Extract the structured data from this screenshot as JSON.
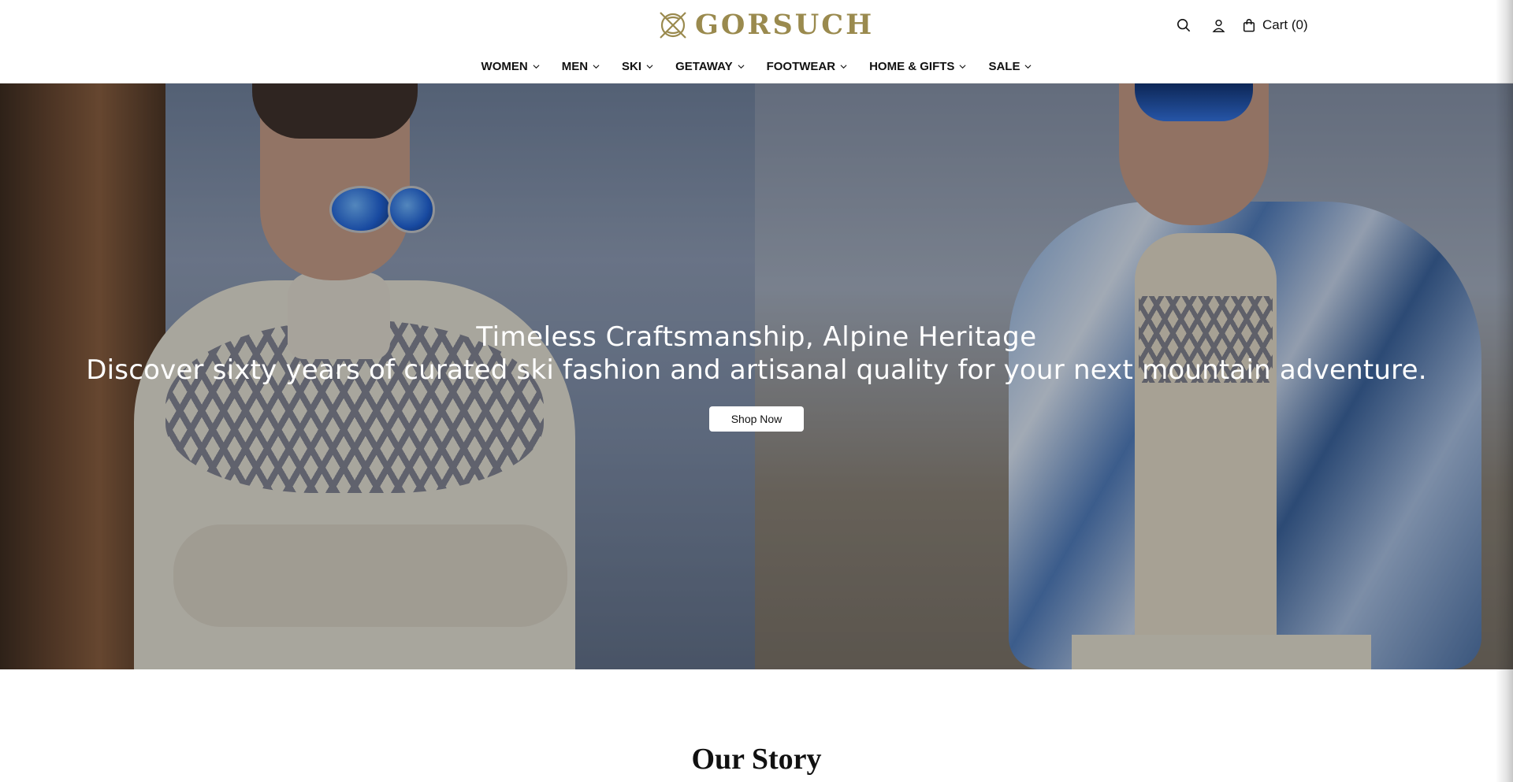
{
  "brand": {
    "logo_text": "GORSUCH",
    "logo_icon": "crossed-skis-crest-icon",
    "accent_color": "#9a8a4e"
  },
  "utility": {
    "search_icon": "search-icon",
    "account_icon": "user-icon",
    "cart_icon": "shopping-bag-icon",
    "cart_label": "Cart (0)"
  },
  "nav": {
    "items": [
      {
        "label": "WOMEN"
      },
      {
        "label": "MEN"
      },
      {
        "label": "SKI"
      },
      {
        "label": "GETAWAY"
      },
      {
        "label": "FOOTWEAR"
      },
      {
        "label": "HOME & GIFTS"
      },
      {
        "label": "SALE"
      }
    ]
  },
  "hero": {
    "title": "Timeless Craftsmanship, Alpine Heritage",
    "subtitle": "Discover sixty years of curated ski fashion and artisanal quality for your next mountain adventure.",
    "cta_label": "Shop Now"
  },
  "story": {
    "title": "Our Story"
  }
}
